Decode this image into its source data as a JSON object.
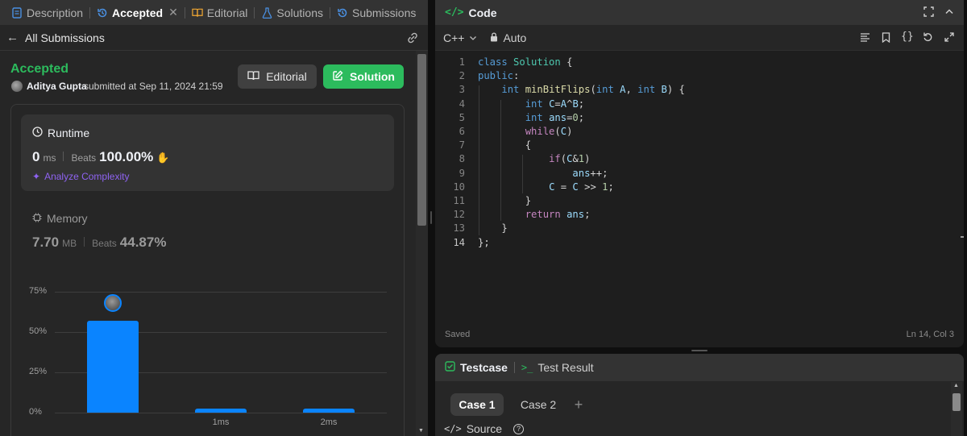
{
  "left_tabs": [
    {
      "label": "Description",
      "icon": "document-icon",
      "active": false
    },
    {
      "label": "Accepted",
      "icon": "history-icon",
      "active": true
    },
    {
      "label": "Editorial",
      "icon": "book-icon",
      "active": false
    },
    {
      "label": "Solutions",
      "icon": "flask-icon",
      "active": false
    },
    {
      "label": "Submissions",
      "icon": "history-icon",
      "active": false
    }
  ],
  "subheader": {
    "back_label": "All Submissions"
  },
  "submission": {
    "status": "Accepted",
    "user": "Aditya Gupta",
    "submitted_text": "submitted at Sep 11, 2024 21:59"
  },
  "buttons": {
    "editorial": "Editorial",
    "solution": "Solution"
  },
  "runtime": {
    "title": "Runtime",
    "value": "0",
    "unit": "ms",
    "beats_label": "Beats",
    "beats_value": "100.00%",
    "analyze_label": "Analyze Complexity"
  },
  "memory": {
    "title": "Memory",
    "value": "7.70",
    "unit": "MB",
    "beats_label": "Beats",
    "beats_value": "44.87%"
  },
  "chart_data": {
    "type": "bar",
    "categories": [
      "",
      "1ms",
      "2ms"
    ],
    "values": [
      57,
      2.5,
      2.5
    ],
    "yticks": [
      "0%",
      "25%",
      "50%",
      "75%"
    ],
    "ylim": [
      0,
      75
    ],
    "bar_color": "#0a84ff",
    "highlight_index": 0
  },
  "code_panel": {
    "title": "Code",
    "language": "C++",
    "mode": "Auto",
    "saved_label": "Saved",
    "cursor_pos": "Ln 14, Col 3",
    "current_line": 14,
    "lines": [
      "class Solution {",
      "public:",
      "    int minBitFlips(int A, int B) {",
      "        int C=A^B;",
      "        int ans=0;",
      "        while(C)",
      "        {",
      "            if(C&1)",
      "                ans++;",
      "            C = C >> 1;",
      "        }",
      "        return ans;",
      "    }",
      "};"
    ]
  },
  "testcase": {
    "tab_testcase": "Testcase",
    "tab_result": "Test Result",
    "cases": [
      "Case 1",
      "Case 2"
    ],
    "add_symbol": "+",
    "source_label": "Source"
  },
  "colors": {
    "accepted": "#2cbb5d",
    "solution_btn": "#2cbb5d",
    "bar": "#0a84ff",
    "analyze": "#8f63f2"
  }
}
